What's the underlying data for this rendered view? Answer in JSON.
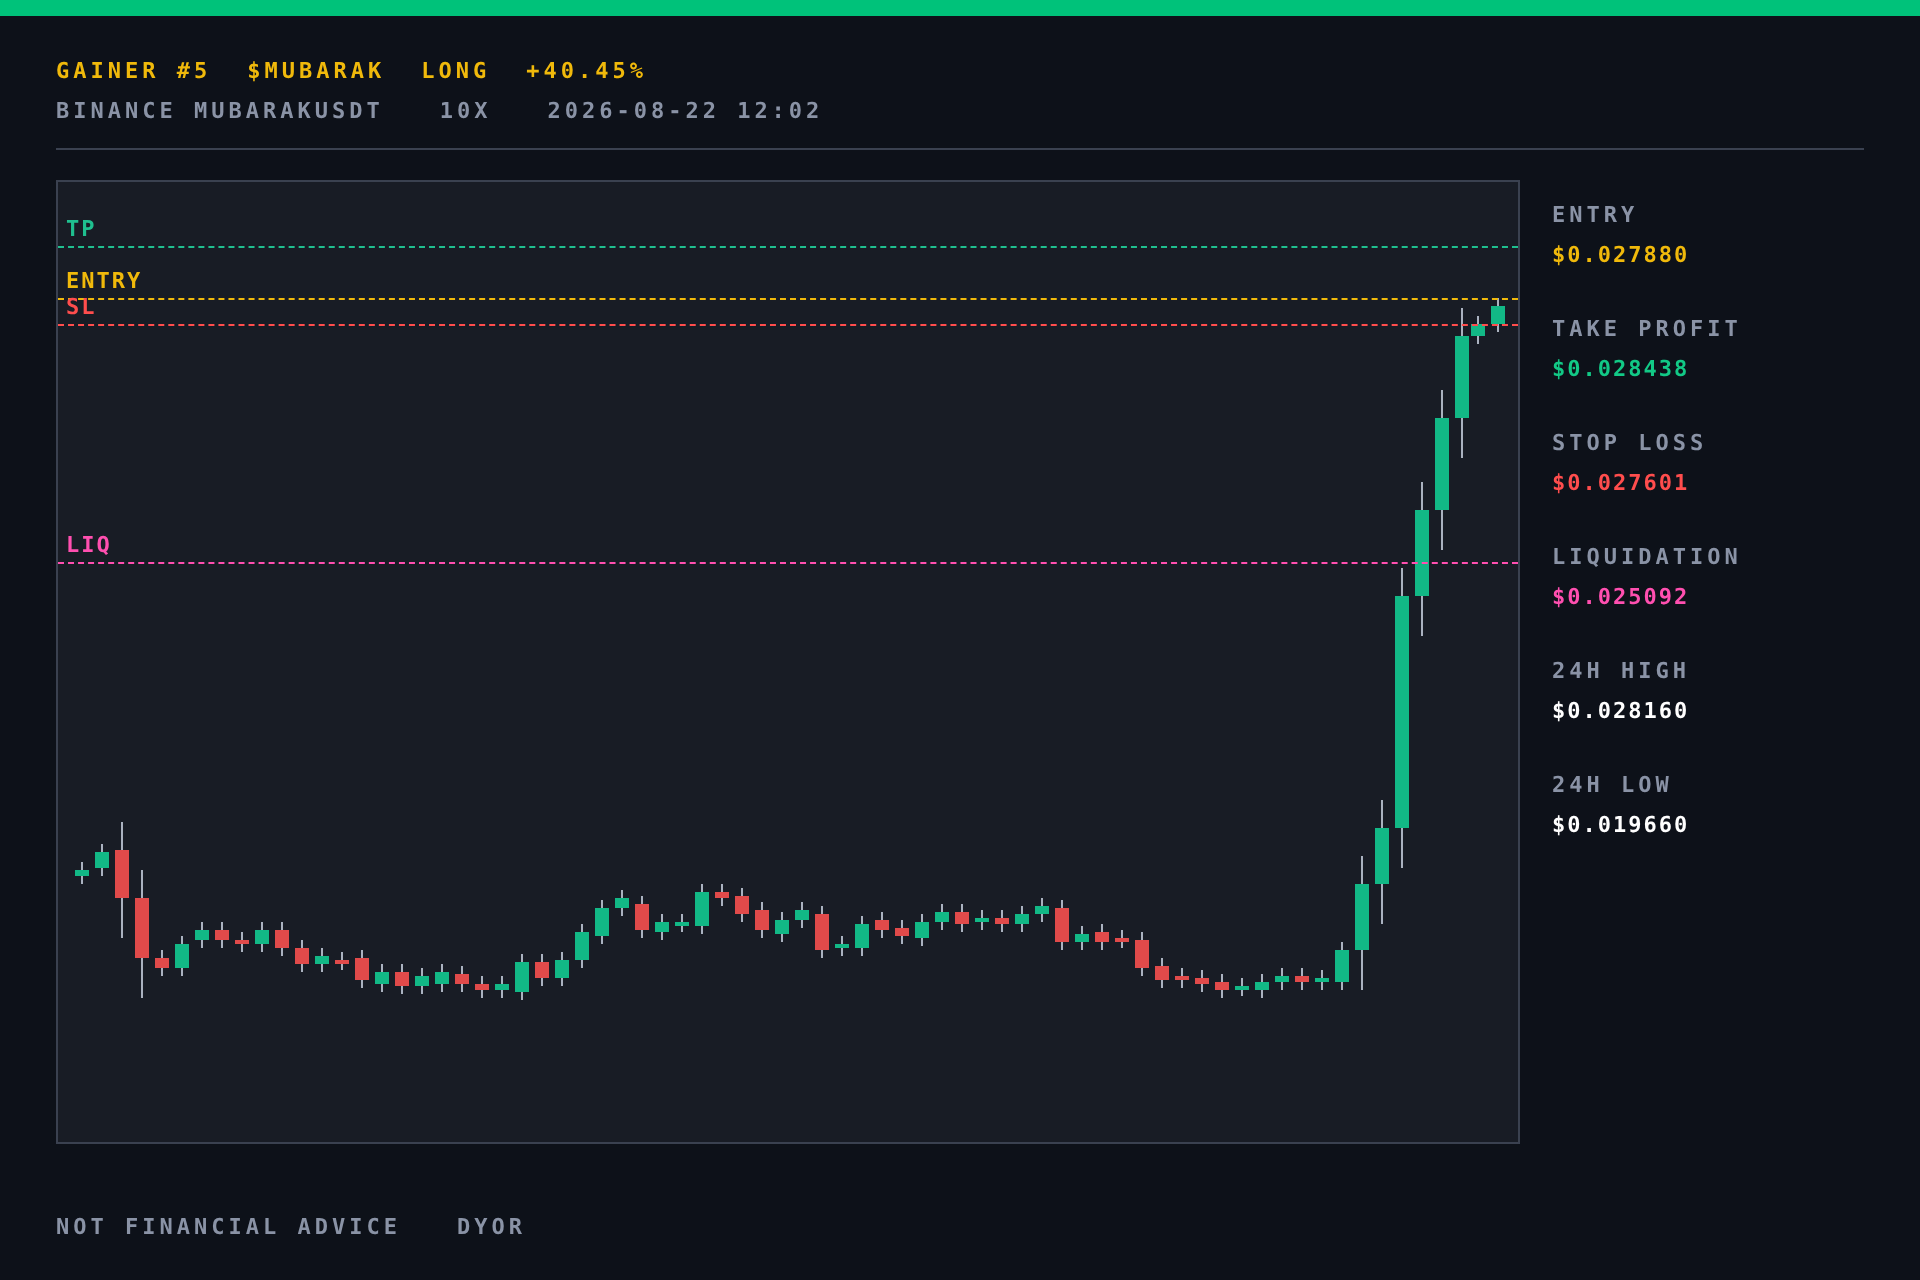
{
  "header": {
    "headline": [
      "GAINER #5",
      "$MUBARAK",
      "LONG",
      "+40.45%"
    ],
    "meta": [
      "BINANCE MUBARAKUSDT",
      "10X",
      "2026-08-22 12:02"
    ]
  },
  "chart": {
    "lines": [
      {
        "label": "TP",
        "color": "#1fbf8f"
      },
      {
        "label": "ENTRY",
        "color": "#f0b90b"
      },
      {
        "label": "SL",
        "color": "#ff4d4d"
      },
      {
        "label": "LIQ",
        "color": "#ff4fb0"
      }
    ]
  },
  "stats": [
    {
      "label": "ENTRY",
      "value": "$0.027880",
      "color": "#f0b90b"
    },
    {
      "label": "TAKE PROFIT",
      "value": "$0.028438",
      "color": "#12c986"
    },
    {
      "label": "STOP LOSS",
      "value": "$0.027601",
      "color": "#ff4d4d"
    },
    {
      "label": "LIQUIDATION",
      "value": "$0.025092",
      "color": "#ff4fb0"
    },
    {
      "label": "24H HIGH",
      "value": "$0.028160",
      "color": "#ffffff"
    },
    {
      "label": "24H LOW",
      "value": "$0.019660",
      "color": "#ffffff"
    }
  ],
  "footer": [
    "NOT FINANCIAL ADVICE",
    "DYOR"
  ]
}
